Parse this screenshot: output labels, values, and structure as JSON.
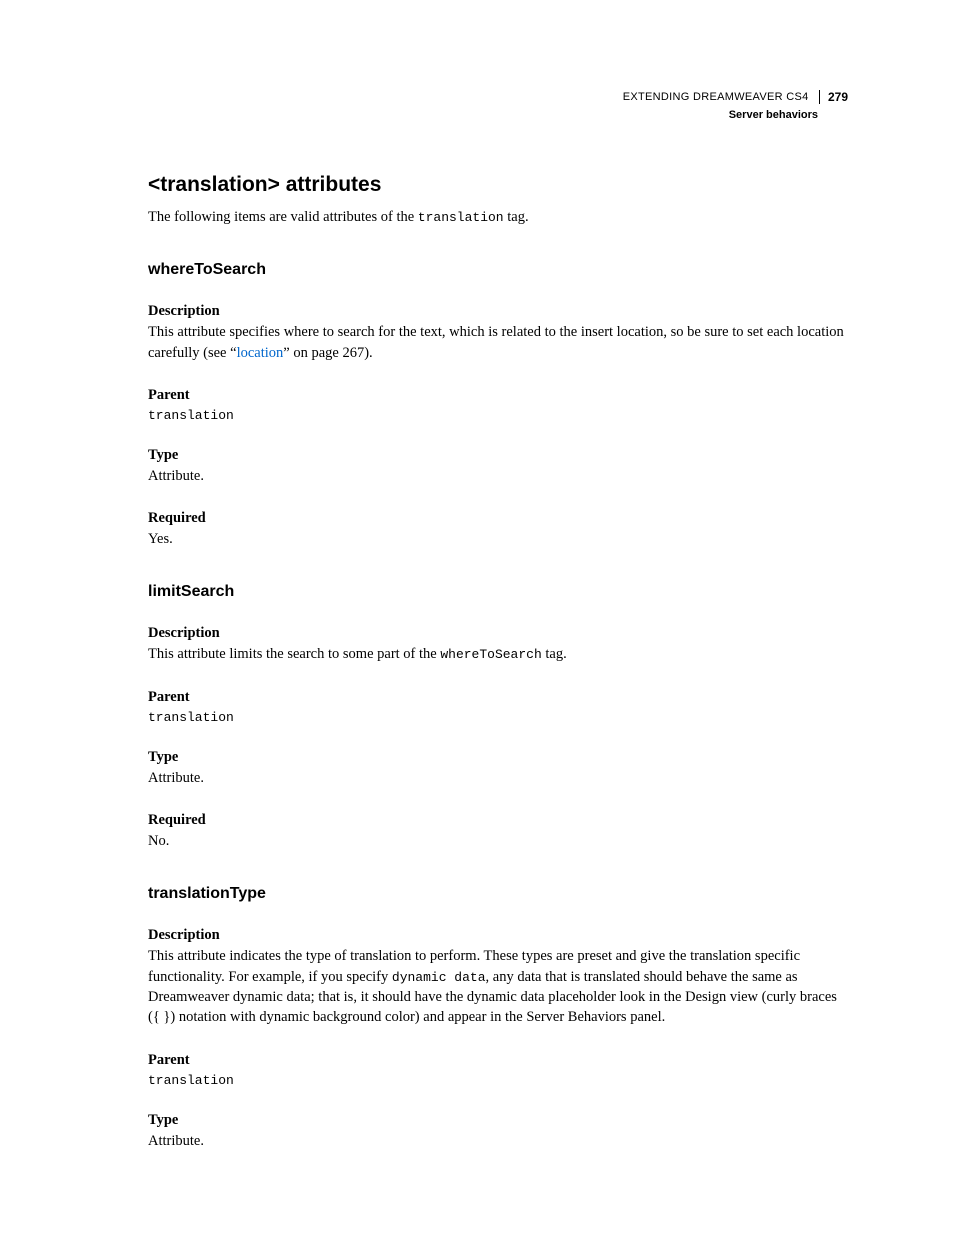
{
  "header": {
    "book_title": "EXTENDING DREAMWEAVER CS4",
    "page_number": "279",
    "section": "Server behaviors"
  },
  "main_heading": "<translation> attributes",
  "intro_text_before": "The following items are valid attributes of the ",
  "intro_code": "translation",
  "intro_text_after": " tag.",
  "sections": {
    "whereToSearch": {
      "title": "whereToSearch",
      "description_label": "Description",
      "description_before": "This attribute specifies where to search for the text, which is related to the insert location, so be sure to set each location carefully (see “",
      "description_link": "location",
      "description_after": "” on page 267).",
      "parent_label": "Parent",
      "parent_value": "translation",
      "type_label": "Type",
      "type_value": "Attribute.",
      "required_label": "Required",
      "required_value": "Yes."
    },
    "limitSearch": {
      "title": "limitSearch",
      "description_label": "Description",
      "description_before": "This attribute limits the search to some part of the ",
      "description_code": "whereToSearch",
      "description_after": " tag.",
      "parent_label": "Parent",
      "parent_value": "translation",
      "type_label": "Type",
      "type_value": "Attribute.",
      "required_label": "Required",
      "required_value": "No."
    },
    "translationType": {
      "title": "translationType",
      "description_label": "Description",
      "description_before": "This attribute indicates the type of translation to perform. These types are preset and give the translation specific functionality. For example, if you specify ",
      "description_code": "dynamic data",
      "description_after": ", any data that is translated should behave the same as Dreamweaver dynamic data; that is, it should have the dynamic data placeholder look in the Design view (curly braces ({ }) notation with dynamic background color) and appear in the Server Behaviors panel.",
      "parent_label": "Parent",
      "parent_value": "translation",
      "type_label": "Type",
      "type_value": "Attribute."
    }
  }
}
